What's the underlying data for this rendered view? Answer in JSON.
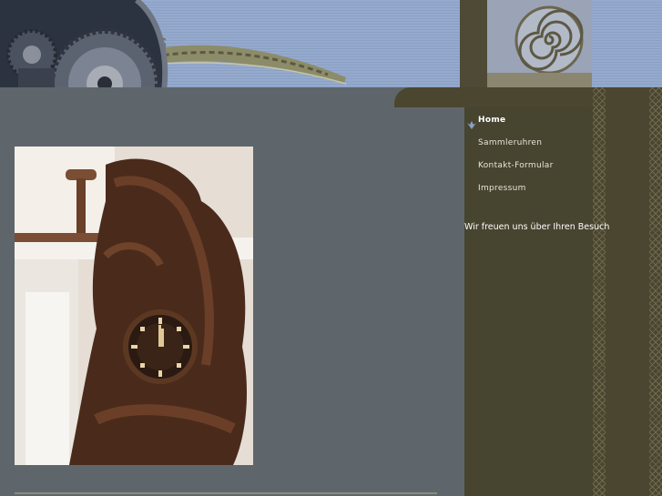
{
  "nav": {
    "items": [
      {
        "label": "Home",
        "active": true
      },
      {
        "label": "Sammleruhren",
        "active": false
      },
      {
        "label": "Kontakt-Formular",
        "active": false
      },
      {
        "label": "Impressum",
        "active": false
      }
    ],
    "active_bullet_icon": "leaf-bullet-icon"
  },
  "welcome_text": "Wir freuen uns über Ihren Besuch",
  "images": {
    "header_gears": "clockwork-gears-icon",
    "header_ornament": "spiral-column-ornament",
    "main_photo": "carved-cuckoo-clock-photo"
  },
  "colors": {
    "sky": "#8aa0c4",
    "main_gray": "#5f666b",
    "sidebar_olive": "#47442f",
    "nav_text": "#e8e6da"
  }
}
